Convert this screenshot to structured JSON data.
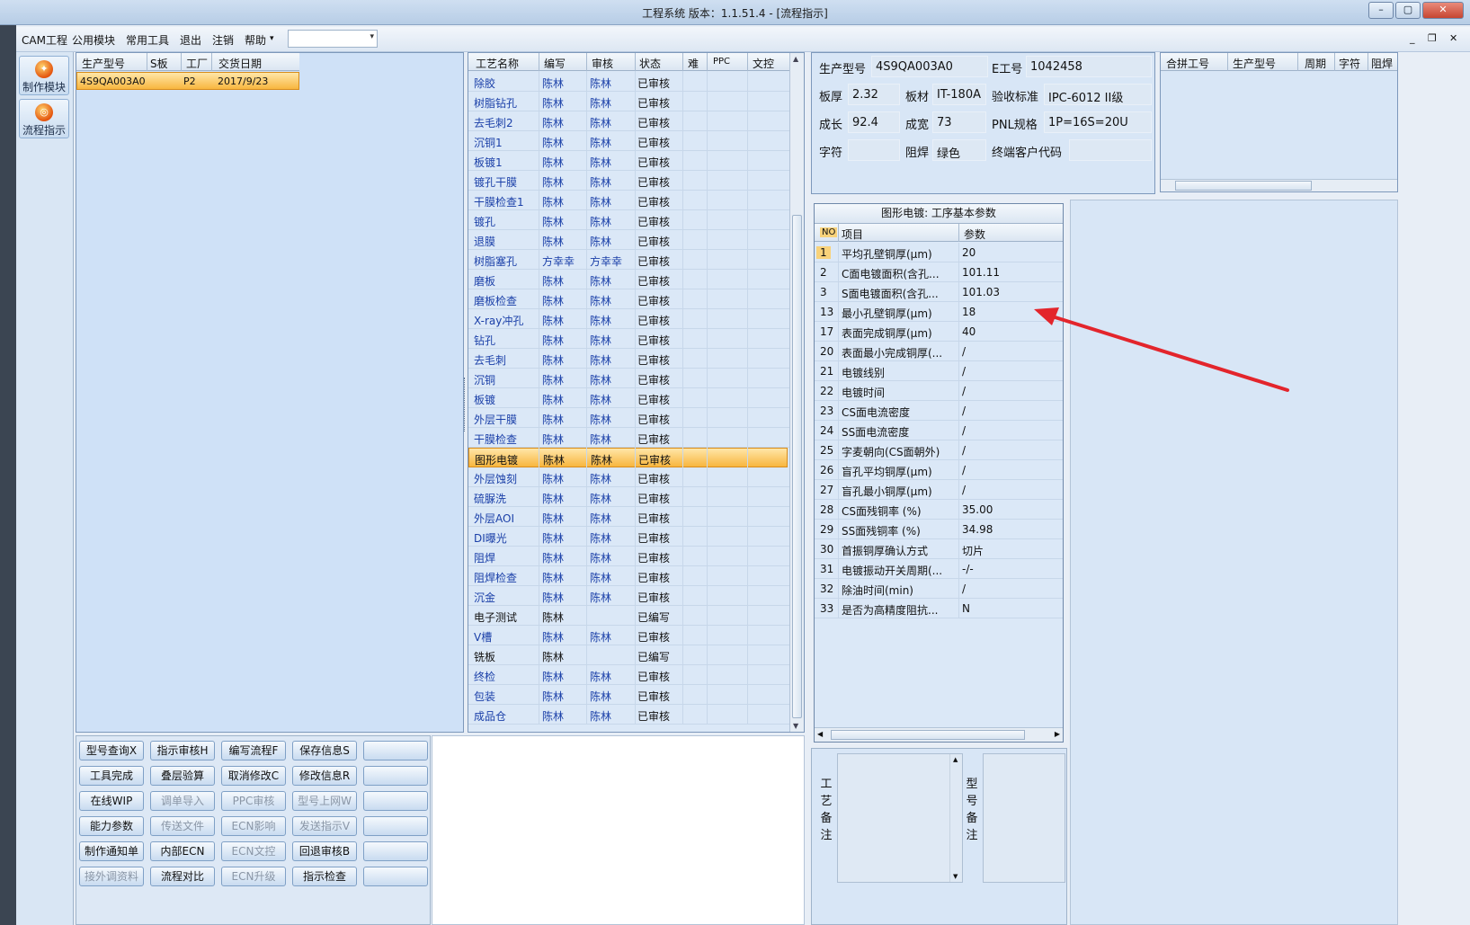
{
  "window": {
    "title": "工程系统  版本：1.1.51.4 - [流程指示]",
    "minimize": "–",
    "maximize": "▢",
    "close": "✕"
  },
  "menu": {
    "items": [
      "CAM工程",
      "公用模块",
      "常用工具",
      "退出",
      "注销",
      "帮助"
    ],
    "help_arrow": "▾",
    "combo_value": "",
    "combo_arrow": "▾",
    "mdi_min": "_",
    "mdi_restore": "❐",
    "mdi_close": "✕"
  },
  "sidenav": {
    "items": [
      {
        "label": "制作模块",
        "icon": "fire-icon"
      },
      {
        "label": "流程指示",
        "icon": "flow-icon"
      }
    ]
  },
  "orders": {
    "columns": [
      "生产型号",
      "S板",
      "工厂",
      "交货日期"
    ],
    "rows": [
      {
        "model": "4S9QA003A0",
        "s": "",
        "factory": "P2",
        "date": "2017/9/23"
      }
    ]
  },
  "process": {
    "columns": [
      "工艺名称",
      "编写",
      "审核",
      "状态",
      "难",
      "PPC",
      "文控"
    ],
    "selected_index": 19,
    "rows": [
      {
        "name": "除胶",
        "writer": "陈林",
        "reviewer": "陈林",
        "status": "已审核"
      },
      {
        "name": "树脂钻孔",
        "writer": "陈林",
        "reviewer": "陈林",
        "status": "已审核"
      },
      {
        "name": "去毛刺2",
        "writer": "陈林",
        "reviewer": "陈林",
        "status": "已审核"
      },
      {
        "name": "沉铜1",
        "writer": "陈林",
        "reviewer": "陈林",
        "status": "已审核"
      },
      {
        "name": "板镀1",
        "writer": "陈林",
        "reviewer": "陈林",
        "status": "已审核"
      },
      {
        "name": "镀孔干膜",
        "writer": "陈林",
        "reviewer": "陈林",
        "status": "已审核"
      },
      {
        "name": "干膜检查1",
        "writer": "陈林",
        "reviewer": "陈林",
        "status": "已审核"
      },
      {
        "name": "镀孔",
        "writer": "陈林",
        "reviewer": "陈林",
        "status": "已审核"
      },
      {
        "name": "退膜",
        "writer": "陈林",
        "reviewer": "陈林",
        "status": "已审核"
      },
      {
        "name": "树脂塞孔",
        "writer": "方幸幸",
        "reviewer": "方幸幸",
        "status": "已审核"
      },
      {
        "name": "磨板",
        "writer": "陈林",
        "reviewer": "陈林",
        "status": "已审核"
      },
      {
        "name": "磨板检查",
        "writer": "陈林",
        "reviewer": "陈林",
        "status": "已审核"
      },
      {
        "name": "X-ray冲孔",
        "writer": "陈林",
        "reviewer": "陈林",
        "status": "已审核"
      },
      {
        "name": "钻孔",
        "writer": "陈林",
        "reviewer": "陈林",
        "status": "已审核"
      },
      {
        "name": "去毛刺",
        "writer": "陈林",
        "reviewer": "陈林",
        "status": "已审核"
      },
      {
        "name": "沉铜",
        "writer": "陈林",
        "reviewer": "陈林",
        "status": "已审核"
      },
      {
        "name": "板镀",
        "writer": "陈林",
        "reviewer": "陈林",
        "status": "已审核"
      },
      {
        "name": "外层干膜",
        "writer": "陈林",
        "reviewer": "陈林",
        "status": "已审核"
      },
      {
        "name": "干膜检查",
        "writer": "陈林",
        "reviewer": "陈林",
        "status": "已审核"
      },
      {
        "name": "图形电镀",
        "writer": "陈林",
        "reviewer": "陈林",
        "status": "已审核"
      },
      {
        "name": "外层蚀刻",
        "writer": "陈林",
        "reviewer": "陈林",
        "status": "已审核"
      },
      {
        "name": "硫脲洗",
        "writer": "陈林",
        "reviewer": "陈林",
        "status": "已审核"
      },
      {
        "name": "外层AOI",
        "writer": "陈林",
        "reviewer": "陈林",
        "status": "已审核"
      },
      {
        "name": "DI曝光",
        "writer": "陈林",
        "reviewer": "陈林",
        "status": "已审核"
      },
      {
        "name": "阻焊",
        "writer": "陈林",
        "reviewer": "陈林",
        "status": "已审核"
      },
      {
        "name": "阻焊检查",
        "writer": "陈林",
        "reviewer": "陈林",
        "status": "已审核"
      },
      {
        "name": "沉金",
        "writer": "陈林",
        "reviewer": "陈林",
        "status": "已审核"
      },
      {
        "name": "电子测试",
        "writer": "陈林",
        "reviewer": "",
        "status": "已编写"
      },
      {
        "name": "V槽",
        "writer": "陈林",
        "reviewer": "陈林",
        "status": "已审核"
      },
      {
        "name": "铣板",
        "writer": "陈林",
        "reviewer": "",
        "status": "已编写"
      },
      {
        "name": "终检",
        "writer": "陈林",
        "reviewer": "陈林",
        "status": "已审核"
      },
      {
        "name": "包装",
        "writer": "陈林",
        "reviewer": "陈林",
        "status": "已审核"
      },
      {
        "name": "成品仓",
        "writer": "陈林",
        "reviewer": "陈林",
        "status": "已审核"
      }
    ]
  },
  "info": {
    "model_label": "生产型号",
    "model": "4S9QA003A0",
    "e_label": "E工号",
    "e_no": "1042458",
    "thick_label": "板厚",
    "thick": "2.32",
    "material_label": "板材",
    "material": "IT-180A",
    "std_label": "验收标准",
    "std": "IPC-6012 II级",
    "len_label": "成长",
    "len": "92.4",
    "width_label": "成宽",
    "width": "73",
    "pnl_label": "PNL规格",
    "pnl": "1P=16S=20U",
    "char_label": "字符",
    "char": "",
    "mask_label": "阻焊",
    "mask": "绿色",
    "cust_label": "终端客户代码",
    "cust": ""
  },
  "combine": {
    "columns": [
      "合拼工号",
      "生产型号",
      "周期",
      "字符",
      "阻焊"
    ]
  },
  "params": {
    "title": "图形电镀: 工序基本参数",
    "columns": [
      "NO",
      "项目",
      "参数"
    ],
    "rows": [
      {
        "no": "1",
        "item": "平均孔壁铜厚(μm)",
        "value": "20"
      },
      {
        "no": "2",
        "item": "C面电镀面积(含孔...",
        "value": "101.11"
      },
      {
        "no": "3",
        "item": "S面电镀面积(含孔...",
        "value": "101.03"
      },
      {
        "no": "13",
        "item": "最小孔壁铜厚(μm)",
        "value": "18"
      },
      {
        "no": "17",
        "item": "表面完成铜厚(μm)",
        "value": "40"
      },
      {
        "no": "20",
        "item": "表面最小完成铜厚(...",
        "value": "/"
      },
      {
        "no": "21",
        "item": "电镀线别",
        "value": "/"
      },
      {
        "no": "22",
        "item": "电镀时间",
        "value": "/"
      },
      {
        "no": "23",
        "item": "CS面电流密度",
        "value": "/"
      },
      {
        "no": "24",
        "item": "SS面电流密度",
        "value": "/"
      },
      {
        "no": "25",
        "item": "字麦朝向(CS面朝外)",
        "value": "/"
      },
      {
        "no": "26",
        "item": "盲孔平均铜厚(μm)",
        "value": "/"
      },
      {
        "no": "27",
        "item": "盲孔最小铜厚(μm)",
        "value": "/"
      },
      {
        "no": "28",
        "item": "CS面残铜率 (%)",
        "value": "35.00"
      },
      {
        "no": "29",
        "item": "SS面残铜率 (%)",
        "value": "34.98"
      },
      {
        "no": "30",
        "item": "首振铜厚确认方式",
        "value": "切片"
      },
      {
        "no": "31",
        "item": "电镀振动开关周期(...",
        "value": "-/-"
      },
      {
        "no": "32",
        "item": "除油时间(min)",
        "value": "/"
      },
      {
        "no": "33",
        "item": "是否为高精度阻抗...",
        "value": "N"
      }
    ]
  },
  "buttons": [
    [
      "型号查询X",
      "指示审核H",
      "编写流程F",
      "保存信息S",
      ""
    ],
    [
      "工具完成",
      "叠层验算",
      "取消修改C",
      "修改信息R",
      ""
    ],
    [
      "在线WIP",
      "调单导入",
      "PPC审核",
      "型号上网W",
      ""
    ],
    [
      "能力参数",
      "传送文件",
      "ECN影响",
      "发送指示V",
      ""
    ],
    [
      "制作通知单",
      "内部ECN",
      "ECN文控",
      "回退审核B",
      ""
    ],
    [
      "接外调资料",
      "流程对比",
      "ECN升级",
      "指示检查",
      ""
    ]
  ],
  "remarks": {
    "process_label": "工艺备注",
    "model_label": "型号备注",
    "process_text": "",
    "model_text": ""
  },
  "colors": {
    "selected_row": "#f8b63f",
    "annotation_arrow": "#e3252c",
    "link_text": "#1a3fa8"
  }
}
